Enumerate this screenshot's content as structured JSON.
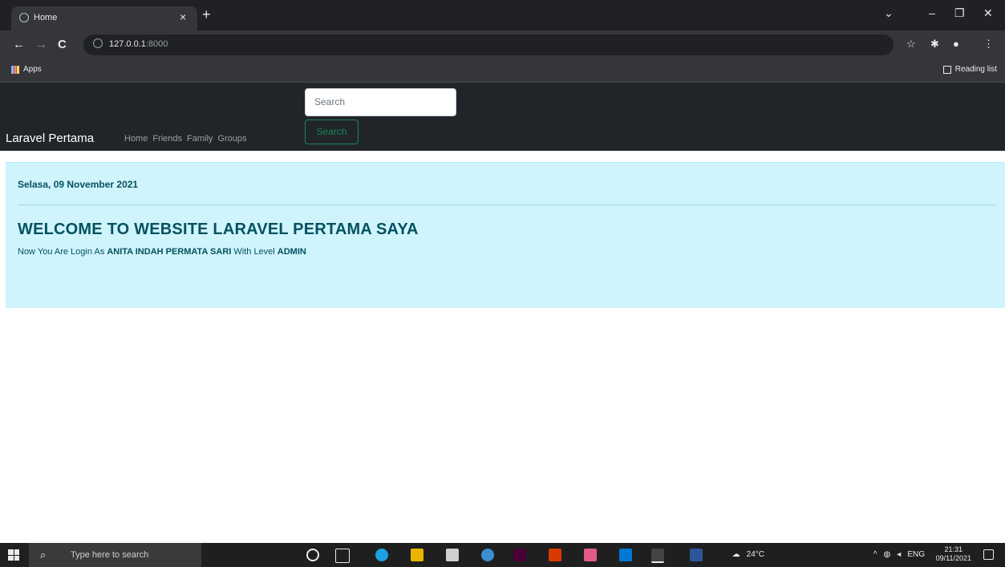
{
  "browser": {
    "tab": {
      "title": "Home",
      "close": "×",
      "new_tab": "+"
    },
    "window_controls": {
      "dropdown": "⌄",
      "minimize": "–",
      "maximize": "❐",
      "close": "✕"
    },
    "nav": {
      "back": "←",
      "forward": "→",
      "reload": "C"
    },
    "url": {
      "host": "127.0.0.1",
      "port": ":8000"
    },
    "bookmarks": {
      "apps": "Apps",
      "reading_list": "Reading list"
    }
  },
  "navbar": {
    "brand": "Laravel Pertama",
    "links": [
      "Home",
      "Friends",
      "Family",
      "Groups"
    ],
    "search_placeholder": "Search",
    "search_button": "Search"
  },
  "alert": {
    "date": "Selasa, 09 November 2021",
    "heading": "WELCOME TO WEBSITE LARAVEL PERTAMA SAYA",
    "text_prefix": "Now You Are Login As ",
    "user_name": "ANITA INDAH PERMATA SARI",
    "text_middle": " With Level ",
    "level": "ADMIN"
  },
  "taskbar": {
    "search_text": "Type here to search",
    "temperature": "24°C",
    "language": "ENG",
    "time": "21:31",
    "date": "09/11/2021"
  },
  "colors": {
    "navbar_bg": "#212529",
    "alert_bg": "#cff4fc",
    "alert_text": "#055160",
    "search_button": "#198754"
  }
}
